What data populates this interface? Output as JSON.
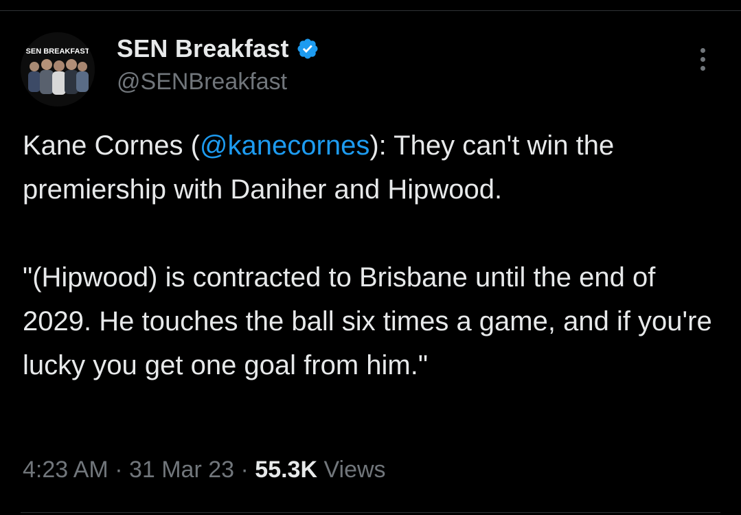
{
  "account": {
    "display_name": "SEN Breakfast",
    "handle": "@SENBreakfast",
    "avatar_text": "SEN BREAKFAST",
    "verified_icon": "verified-badge-icon",
    "verified_color": "#1d9bf0"
  },
  "tweet": {
    "line1_prefix": "Kane Cornes (",
    "mention": "@kanecornes",
    "line1_suffix": "): They can't win the premiership with Daniher and Hipwood.",
    "paragraph2": "\"(Hipwood) is contracted to Brisbane until the end of 2029. He touches the ball six times a game, and if you're lucky you get one goal from him.\""
  },
  "meta": {
    "time": "4:23 AM",
    "separator": " · ",
    "date": "31 Mar 23",
    "views_count": "55.3K",
    "views_label": " Views"
  },
  "colors": {
    "background": "#000000",
    "text": "#e7e9ea",
    "secondary": "#71767b",
    "link": "#1d9bf0"
  }
}
